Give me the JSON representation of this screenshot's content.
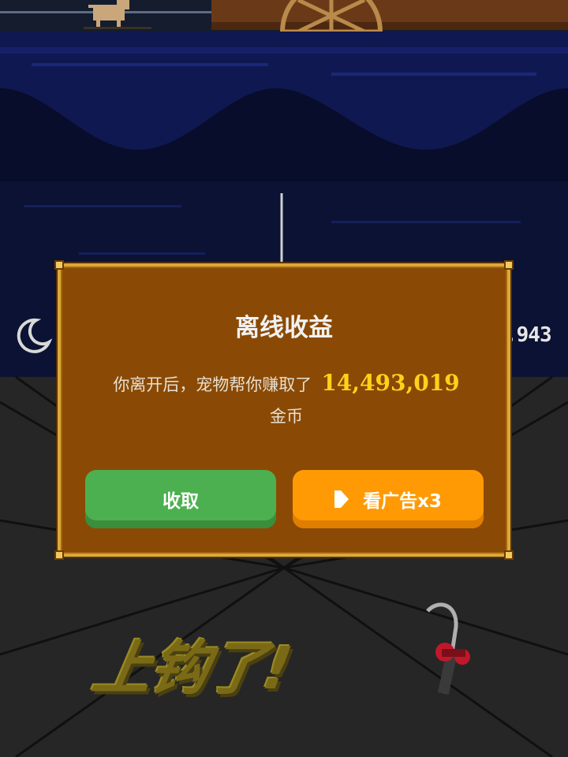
{
  "hud": {
    "coin_count_partial": ",943",
    "moon_icon": "moon-icon"
  },
  "dialog": {
    "title": "离线收益",
    "message_before": "你离开后，宠物帮你赚取了",
    "amount": "14,493,019",
    "message_after": "金币",
    "collect_label": "收取",
    "ad_label": "看广告x3",
    "ad_icon": "play-icon"
  },
  "banner": {
    "hooked_text": "上钩了!"
  },
  "colors": {
    "dialog_bg": "#8a4a05",
    "dialog_border": "#d9a93a",
    "amount": "#ffd21a",
    "collect_button": "#4cb050",
    "ad_button": "#ff9a05"
  }
}
